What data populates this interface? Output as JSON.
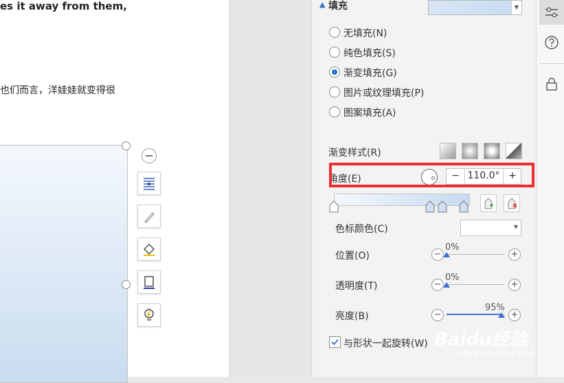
{
  "document": {
    "line1": "es it away from them,",
    "line2": "也们而言，洋娃娃就变得很"
  },
  "fill_section": {
    "title": "填充",
    "options": [
      {
        "label": "无填充(N)",
        "selected": false
      },
      {
        "label": "纯色填充(S)",
        "selected": false
      },
      {
        "label": "渐变填充(G)",
        "selected": true
      },
      {
        "label": "图片或纹理填充(P)",
        "selected": false
      },
      {
        "label": "图案填充(A)",
        "selected": false
      }
    ]
  },
  "gradient": {
    "style_label": "渐变样式(R)",
    "angle_label": "角度(E)",
    "angle_minus": "−",
    "angle_value": "110.0°",
    "angle_plus": "+",
    "stop_color_label": "色标颜色(C)",
    "position_label": "位置(O)",
    "position_value": "0%",
    "position_fraction": 0,
    "transparency_label": "透明度(T)",
    "transparency_value": "0%",
    "transparency_fraction": 0,
    "brightness_label": "亮度(B)",
    "brightness_value": "95%",
    "brightness_fraction": 0.95,
    "rotate_with_shape_label": "与形状一起旋转(W)",
    "rotate_with_shape_checked": true
  },
  "watermark": {
    "brand": "Baidu经验",
    "url": "jingyan.baidu.com"
  },
  "colors": {
    "accent": "#2b73c9",
    "highlight": "#ee2f2f",
    "gradient_light": "#f4f8fd",
    "gradient_dark": "#c9dcf0"
  }
}
